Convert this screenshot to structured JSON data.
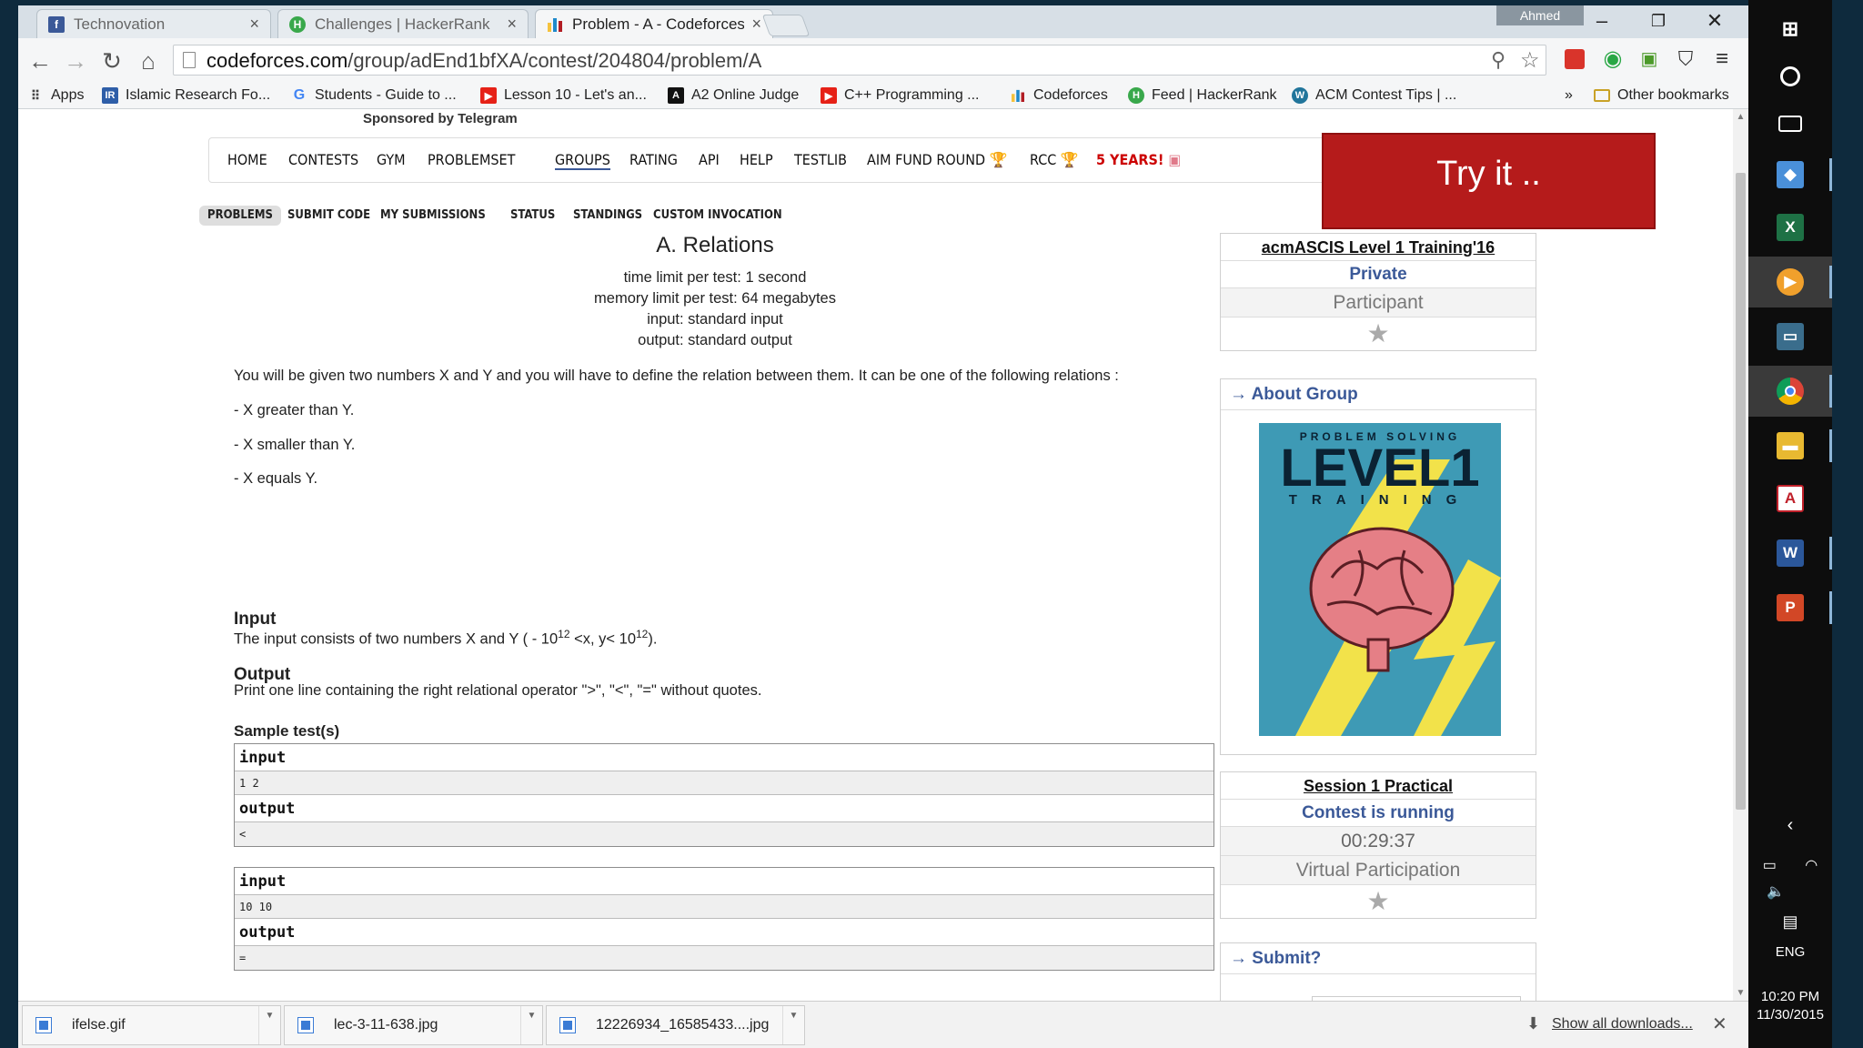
{
  "browser": {
    "tabs": [
      {
        "label": "Technovation",
        "icon": "facebook-icon"
      },
      {
        "label": "Challenges | HackerRank",
        "icon": "hackerrank-icon"
      },
      {
        "label": "Problem - A - Codeforces",
        "icon": "codeforces-icon"
      }
    ],
    "profile": "Ahmed",
    "url_host": "codeforces.com",
    "url_path": "/group/adEnd1bfXA/contest/204804/problem/A",
    "bookmarks": [
      {
        "label": "Apps"
      },
      {
        "label": "Islamic Research Fo..."
      },
      {
        "label": "Students - Guide to ..."
      },
      {
        "label": "Lesson 10 - Let's an..."
      },
      {
        "label": "A2 Online Judge"
      },
      {
        "label": "C++ Programming ..."
      },
      {
        "label": "Codeforces"
      },
      {
        "label": "Feed | HackerRank"
      },
      {
        "label": "ACM Contest Tips | ..."
      }
    ],
    "bookmarks_more": "»",
    "other_bookmarks": "Other bookmarks"
  },
  "page": {
    "sponsored": "Sponsored by Telegram",
    "menu": [
      {
        "label": "Home"
      },
      {
        "label": "Contests"
      },
      {
        "label": "Gym"
      },
      {
        "label": "Problemset"
      },
      {
        "label": "Groups"
      },
      {
        "label": "Rating"
      },
      {
        "label": "API"
      },
      {
        "label": "Help"
      },
      {
        "label": "TESTLIB"
      },
      {
        "label": "AIM Fund Round"
      },
      {
        "label": "RCC"
      },
      {
        "label": "5 YEARS!"
      }
    ],
    "try_it": "Try it ..",
    "subnav": [
      {
        "label": "Problems"
      },
      {
        "label": "Submit Code"
      },
      {
        "label": "My Submissions"
      },
      {
        "label": "Status"
      },
      {
        "label": "Standings"
      },
      {
        "label": "Custom Invocation"
      }
    ],
    "problem": {
      "title": "A. Relations",
      "time_limit": "time limit per test: 1 second",
      "memory_limit": "memory limit per test: 64 megabytes",
      "input_file": "input: standard input",
      "output_file": "output: standard output",
      "statement": "You will be given two numbers X and Y and you will have to define the relation between them. It can be one of the following relations :",
      "relations": [
        "- X greater than Y.",
        "- X smaller than Y.",
        "- X equals Y."
      ],
      "input_title": "Input",
      "input_spec_a": "The input consists of two numbers X and Y ( - 10",
      "input_spec_exp1": "12",
      "input_spec_b": " <x, y< 10",
      "input_spec_exp2": "12",
      "input_spec_c": ").",
      "output_title": "Output",
      "output_spec": "Print one line containing the right relational operator \">\", \"<\", \"=\" without quotes.",
      "samples_title": "Sample test(s)",
      "samples": [
        {
          "input_label": "input",
          "input": "1 2",
          "output_label": "output",
          "output": "<"
        },
        {
          "input_label": "input",
          "input": "10 10",
          "output_label": "output",
          "output": "="
        }
      ]
    },
    "sidebar": {
      "group_name": "acmASCIS Level 1 Training'16",
      "group_type": "Private",
      "role": "Participant",
      "about_title": "→ About Group",
      "poster_top": "PROBLEM SOLVING",
      "poster_main": "LEVEL1",
      "poster_sub": "TRAINING",
      "session_name": "Session 1 Practical",
      "contest_status": "Contest is running",
      "countdown": "00:29:37",
      "virtual": "Virtual Participation",
      "submit_title": "→ Submit?"
    }
  },
  "downloads": {
    "items": [
      {
        "name": "ifelse.gif"
      },
      {
        "name": "lec-3-11-638.jpg"
      },
      {
        "name": "12226934_16585433....jpg"
      }
    ],
    "show_all": "Show all downloads..."
  },
  "os_tray": {
    "language": "ENG",
    "time": "10:20 PM",
    "date": "11/30/2015"
  },
  "colors": {
    "accent_blue": "#3b5998",
    "try_it_red": "#b51b1b",
    "poster_bg": "#3e9ab5",
    "lightning": "#f2e24a"
  }
}
